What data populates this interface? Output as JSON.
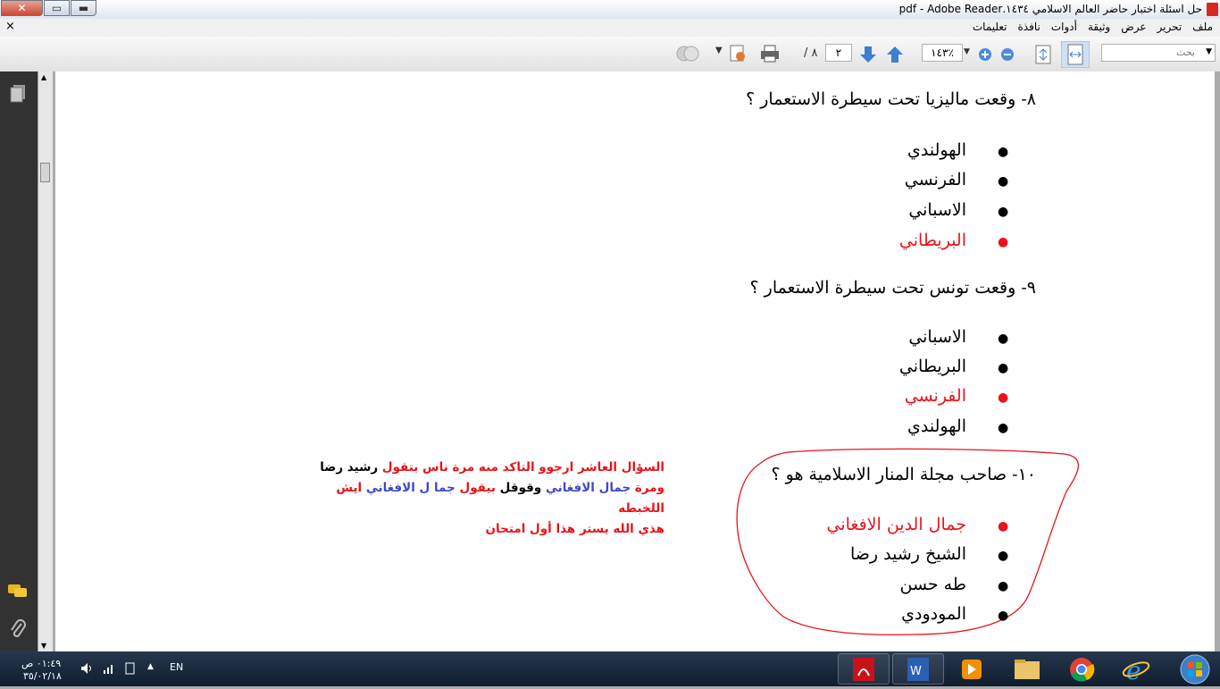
{
  "window": {
    "title": "حل اسئلة اختبار حاضر العالم الاسلامي ١٤٣٤.pdf - Adobe Reader",
    "close_symbol": "✕",
    "maximize_symbol": "▭",
    "minimize_symbol": "▬",
    "app_icon": "pdf-icon"
  },
  "menu": {
    "close_doc": "×",
    "items": [
      "ملف",
      "تحرير",
      "عرض",
      "وثيقة",
      "أدوات",
      "نافذة",
      "تعليمات"
    ]
  },
  "toolbar": {
    "search_placeholder": "بحث",
    "zoom": "١٤٣٪",
    "page_current": "٢",
    "page_total": "/ ٨",
    "icons": [
      "collaborate-icon",
      "dropdown-icon",
      "share-icon",
      "print-icon",
      "page-down-icon",
      "page-up-icon",
      "zoom-in-icon",
      "zoom-out-icon",
      "fit-page-icon",
      "fit-width-icon"
    ]
  },
  "questions": [
    {
      "text": "٨- وقعت ماليزيا تحت سيطرة الاستعمار ؟",
      "options": [
        {
          "text": "الهولندي",
          "correct": false
        },
        {
          "text": "الفرنسي",
          "correct": false
        },
        {
          "text": "الاسباني",
          "correct": false
        },
        {
          "text": "البريطاني",
          "correct": true
        }
      ]
    },
    {
      "text": "٩- وقعت تونس تحت سيطرة الاستعمار ؟",
      "options": [
        {
          "text": "الاسباني",
          "correct": false
        },
        {
          "text": "البريطاني",
          "correct": false
        },
        {
          "text": "الفرنسي",
          "correct": true
        },
        {
          "text": "الهولندي",
          "correct": false
        }
      ]
    },
    {
      "text": "١٠- صاحب مجلة المنار الاسلامية هو ؟",
      "options": [
        {
          "text": "جمال الدين الافغاني",
          "correct": true
        },
        {
          "text": "الشيخ رشيد رضا",
          "correct": false
        },
        {
          "text": "طه حسن",
          "correct": false
        },
        {
          "text": "المودودي",
          "correct": false
        }
      ]
    }
  ],
  "bullet": "●",
  "note": {
    "l1_a": "السؤال العاشر ارجوو التاكد منه مرة ناس بتقول ",
    "l1_b": "رشيد رضا",
    "l2_a": "ومرة ",
    "l2_b": "جمال الافغاني",
    "l2_c": " وقوقل ",
    "l2_d": "بيقول ",
    "l2_e": "جما ل الافغاني",
    "l2_f": " ايش اللخبطه",
    "l3": "هذي  الله يستر هذا أول امتحان"
  },
  "colors": {
    "answer": "#e8141a",
    "note_blue": "#3d47c8",
    "annotation": "#e8141a"
  },
  "taskbar": {
    "time": "٠١:٤٩ ص",
    "date": "٣٥/٠٢/١٨",
    "lang": "EN",
    "apps": [
      "adobe-reader-icon",
      "word-icon",
      "media-player-icon",
      "explorer-icon",
      "chrome-icon",
      "ie-icon",
      "start-orb-icon"
    ]
  },
  "sidebar": {
    "icons": [
      "pages-icon",
      "comments-icon",
      "attachments-icon"
    ]
  }
}
